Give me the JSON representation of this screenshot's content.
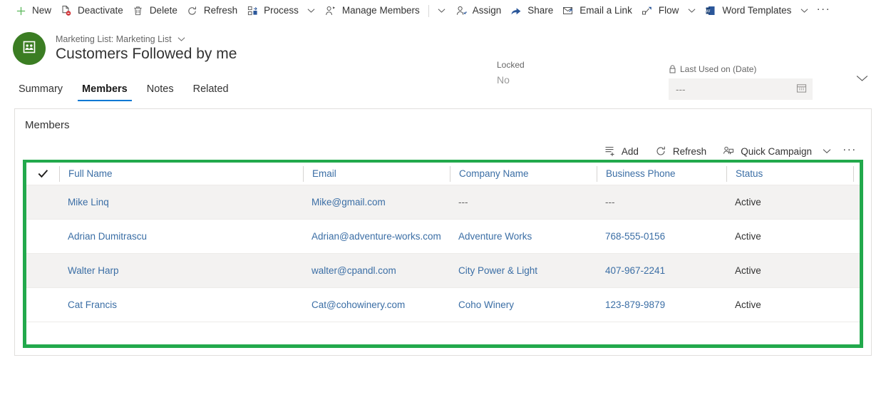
{
  "commandbar": {
    "items": [
      {
        "label": "New",
        "icon": "plus-icon",
        "caret": false
      },
      {
        "label": "Deactivate",
        "icon": "deactivate-icon",
        "caret": false
      },
      {
        "label": "Delete",
        "icon": "trash-icon",
        "caret": false
      },
      {
        "label": "Refresh",
        "icon": "refresh-icon",
        "caret": false
      },
      {
        "label": "Process",
        "icon": "process-icon",
        "caret": true
      },
      {
        "label": "Manage Members",
        "icon": "manage-members-icon",
        "caret": false
      },
      {
        "label": "Assign",
        "icon": "assign-icon",
        "caret": false
      },
      {
        "label": "Share",
        "icon": "share-icon",
        "caret": false
      },
      {
        "label": "Email a Link",
        "icon": "email-link-icon",
        "caret": false
      },
      {
        "label": "Flow",
        "icon": "flow-icon",
        "caret": true
      },
      {
        "label": "Word Templates",
        "icon": "word-icon",
        "caret": true
      }
    ],
    "overflow_label": "···"
  },
  "record": {
    "entity_label": "Marketing List: Marketing List",
    "title": "Customers Followed by me",
    "avatar_icon": "marketing-list-icon",
    "accent_green": "#3b7d23",
    "locked": {
      "label": "Locked",
      "value": "No"
    },
    "last_used": {
      "label": "Last Used on (Date)",
      "value": "---",
      "lock_icon": "lock-icon",
      "calendar_icon": "calendar-icon"
    }
  },
  "tabs": {
    "items": [
      {
        "label": "Summary",
        "active": false
      },
      {
        "label": "Members",
        "active": true
      },
      {
        "label": "Notes",
        "active": false
      },
      {
        "label": "Related",
        "active": false
      }
    ],
    "active_underline_color": "#0078d4"
  },
  "subgrid": {
    "title": "Members",
    "highlight_color": "#22a94c",
    "toolbar": [
      {
        "label": "Add",
        "icon": "add-row-icon",
        "caret": false
      },
      {
        "label": "Refresh",
        "icon": "refresh-icon",
        "caret": false
      },
      {
        "label": "Quick Campaign",
        "icon": "quick-campaign-icon",
        "caret": true
      }
    ],
    "toolbar_overflow": "···",
    "select_all_icon": "checkmark-icon",
    "columns": [
      "Full Name",
      "Email",
      "Company Name",
      "Business Phone",
      "Status"
    ],
    "rows": [
      {
        "full_name": "Mike Linq",
        "email": "Mike@gmail.com",
        "company_name": "---",
        "business_phone": "---",
        "status": "Active"
      },
      {
        "full_name": "Adrian Dumitrascu",
        "email": "Adrian@adventure-works.com",
        "company_name": "Adventure Works",
        "business_phone": "768-555-0156",
        "status": "Active"
      },
      {
        "full_name": "Walter Harp",
        "email": "walter@cpandl.com",
        "company_name": "City Power & Light",
        "business_phone": "407-967-2241",
        "status": "Active"
      },
      {
        "full_name": "Cat Francis",
        "email": "Cat@cohowinery.com",
        "company_name": "Coho Winery",
        "business_phone": "123-879-9879",
        "status": "Active"
      }
    ]
  }
}
